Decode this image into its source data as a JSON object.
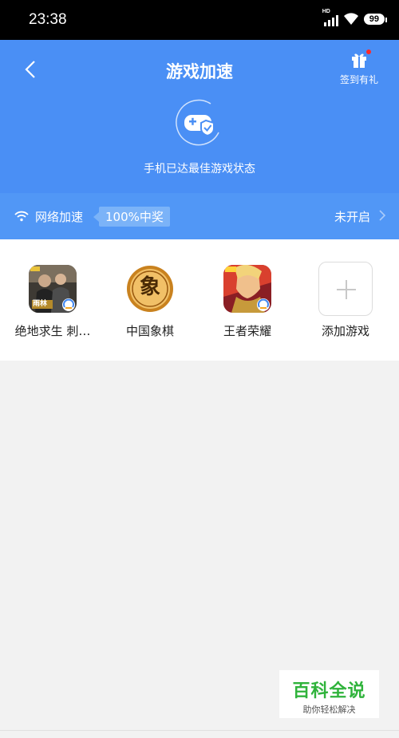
{
  "status_bar": {
    "time": "23:38",
    "network_label": "HD",
    "battery": "99"
  },
  "header": {
    "title": "游戏加速",
    "checkin_label": "签到有礼",
    "status_text": "手机已达最佳游戏状态"
  },
  "network": {
    "label": "网络加速",
    "promo": "100%中奖",
    "state": "未开启"
  },
  "games": [
    {
      "name": "绝地求生 刺…",
      "icon": "pubg-icon"
    },
    {
      "name": "中国象棋",
      "icon": "chinese-chess-icon",
      "glyph": "象"
    },
    {
      "name": "王者荣耀",
      "icon": "honor-of-kings-icon"
    },
    {
      "name": "添加游戏",
      "icon": "plus-icon"
    }
  ],
  "pubg_badge": "雨林",
  "watermark": {
    "title": "百科全说",
    "subtitle": "助你轻松解决"
  },
  "colors": {
    "header": "#4a8ff5",
    "network_row": "#5197f6",
    "watermark_green": "#2fb33b"
  }
}
